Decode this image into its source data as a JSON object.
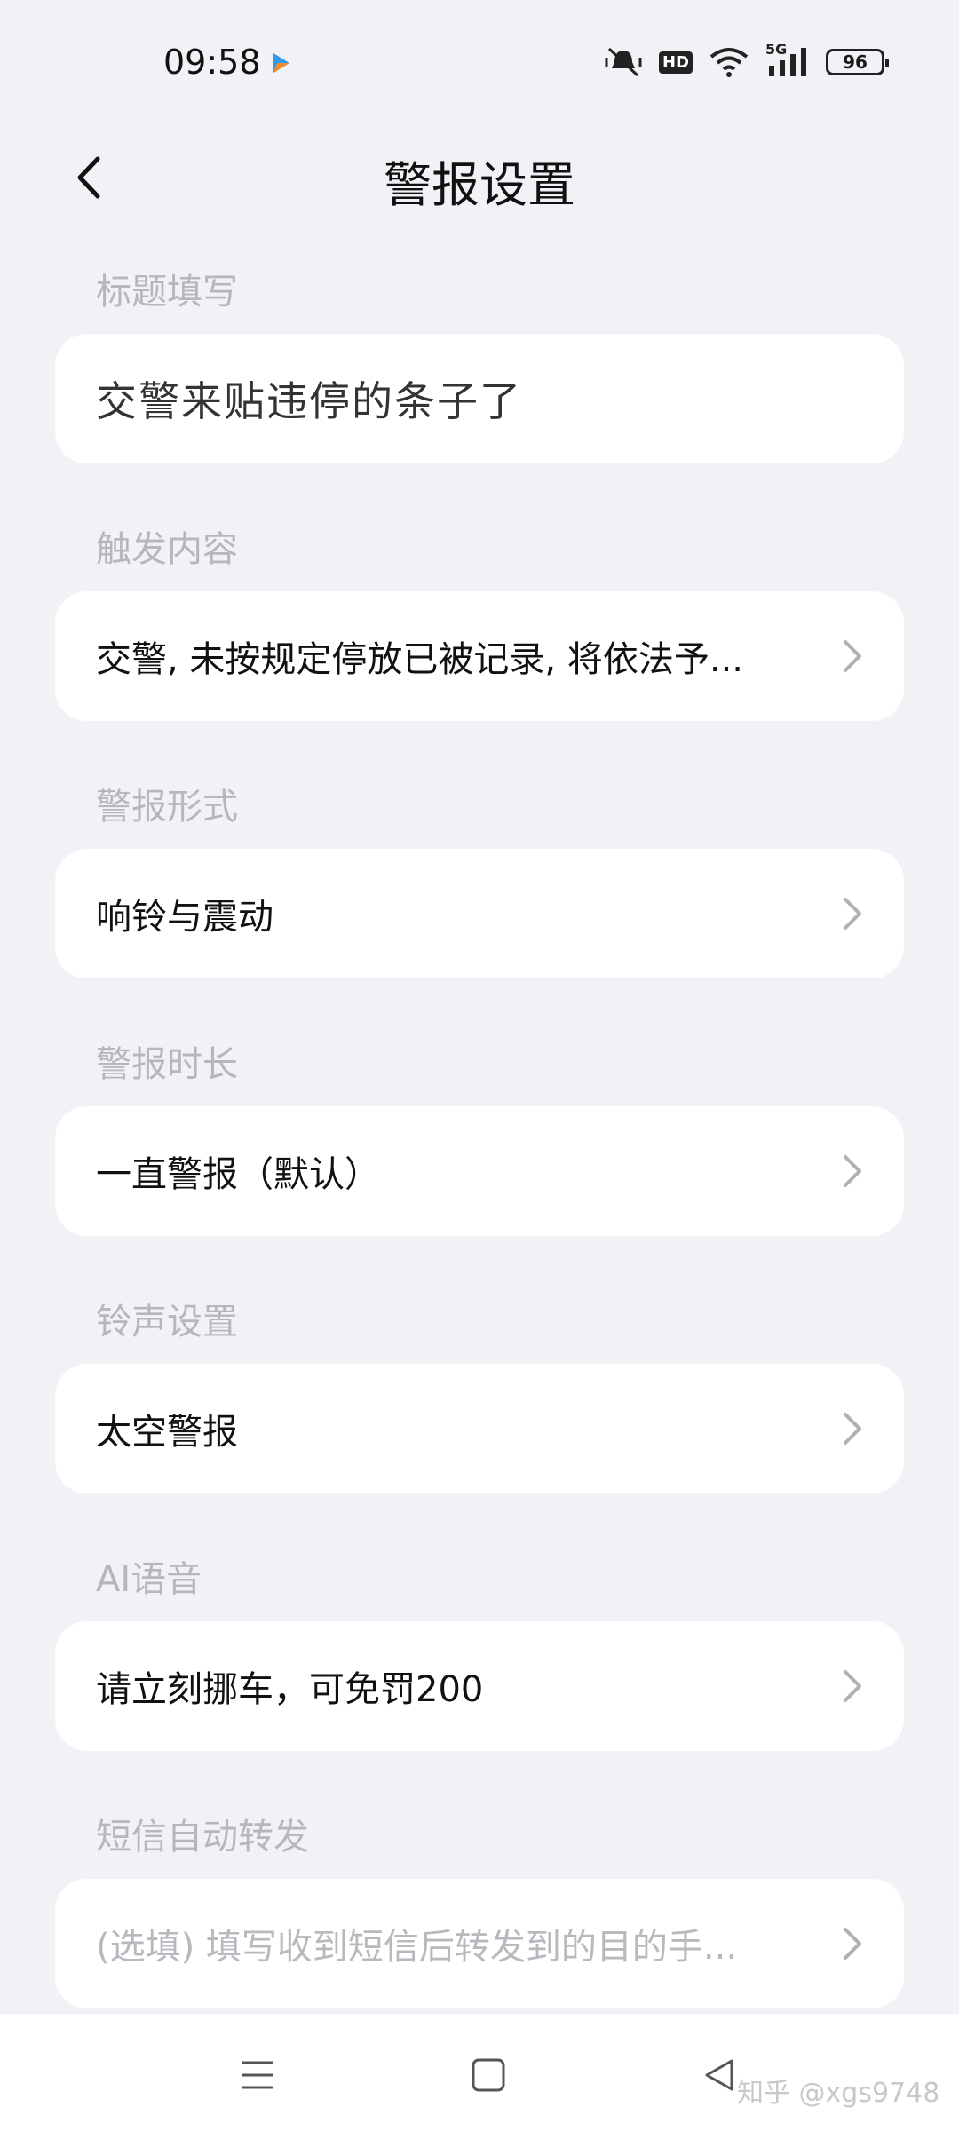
{
  "status_bar": {
    "time": "09:58",
    "network_label": "5G",
    "hd_label": "HD",
    "battery": "96"
  },
  "header": {
    "title": "警报设置"
  },
  "sections": [
    {
      "label": "标题填写",
      "value": "交警来贴违停的条子了",
      "placeholder": false,
      "chevron": false
    },
    {
      "label": "触发内容",
      "value": "交警, 未按规定停放已被记录, 将依法予...",
      "placeholder": false,
      "chevron": true
    },
    {
      "label": "警报形式",
      "value": "响铃与震动",
      "placeholder": false,
      "chevron": true
    },
    {
      "label": "警报时长",
      "value": "一直警报（默认）",
      "placeholder": false,
      "chevron": true
    },
    {
      "label": "铃声设置",
      "value": "太空警报",
      "placeholder": false,
      "chevron": true
    },
    {
      "label": "AI语音",
      "value": "请立刻挪车，可免罚200",
      "placeholder": false,
      "chevron": true
    },
    {
      "label": "短信自动转发",
      "value": "(选填) 填写收到短信后转发到的目的手...",
      "placeholder": true,
      "chevron": true
    }
  ],
  "watermark": "知乎 @xgs9748",
  "colors": {
    "background": "#f2f2f6",
    "card": "#ffffff",
    "section_label": "#b6b6bc",
    "chevron": "#b0b0b6"
  }
}
